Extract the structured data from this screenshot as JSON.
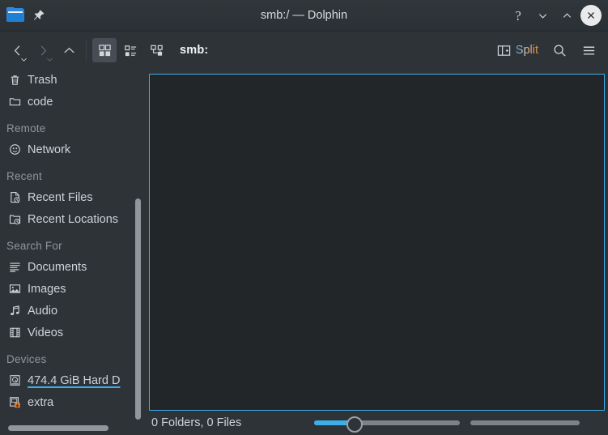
{
  "window": {
    "title": "smb:/ — Dolphin",
    "app_icon": "folder-icon",
    "pin_icon": "pin-icon",
    "controls": [
      {
        "name": "help-button",
        "icon": "question-mark-icon",
        "glyph": "?"
      },
      {
        "name": "minimize-button",
        "icon": "chevron-down-icon"
      },
      {
        "name": "maximize-button",
        "icon": "chevron-up-icon"
      },
      {
        "name": "close-button",
        "icon": "close-x-icon"
      }
    ]
  },
  "toolbar": {
    "back": {
      "label": "Back",
      "icon": "chevron-left-icon",
      "enabled": true
    },
    "forward": {
      "label": "Forward",
      "icon": "chevron-right-icon",
      "enabled": false
    },
    "up": {
      "label": "Up",
      "icon": "chevron-up-icon",
      "enabled": true
    },
    "view_modes": [
      {
        "name": "icons-view",
        "icon": "grid-icon",
        "active": true
      },
      {
        "name": "compact-view",
        "icon": "list-icon",
        "active": false
      },
      {
        "name": "details-view",
        "icon": "tree-icon",
        "active": false
      }
    ],
    "breadcrumb": "smb:",
    "split_label": "Split",
    "split_icon": "split-view-icon",
    "search_icon": "search-icon",
    "menu_icon": "hamburger-menu-icon"
  },
  "sidebar": {
    "groups": [
      {
        "heading": null,
        "items": [
          {
            "label": "Trash",
            "icon": "trash-icon",
            "hovered": false
          },
          {
            "label": "code",
            "icon": "folder-icon",
            "hovered": false
          }
        ]
      },
      {
        "heading": "Remote",
        "items": [
          {
            "label": "Network",
            "icon": "network-icon",
            "hovered": false
          }
        ]
      },
      {
        "heading": "Recent",
        "items": [
          {
            "label": "Recent Files",
            "icon": "recent-files-icon",
            "hovered": false
          },
          {
            "label": "Recent Locations",
            "icon": "recent-locations-icon",
            "hovered": false
          }
        ]
      },
      {
        "heading": "Search For",
        "items": [
          {
            "label": "Documents",
            "icon": "document-icon",
            "hovered": false
          },
          {
            "label": "Images",
            "icon": "image-icon",
            "hovered": false
          },
          {
            "label": "Audio",
            "icon": "audio-note-icon",
            "hovered": false
          },
          {
            "label": "Videos",
            "icon": "film-icon",
            "hovered": false
          }
        ]
      },
      {
        "heading": "Devices",
        "items": [
          {
            "label": "474.4 GiB Hard D",
            "icon": "hard-drive-icon",
            "hovered": true
          },
          {
            "label": "extra",
            "icon": "removable-device-icon",
            "hovered": false
          }
        ]
      }
    ]
  },
  "statusbar": {
    "text": "0 Folders, 0 Files",
    "zoom_value": 22,
    "zoom_min": 0,
    "zoom_max": 100
  },
  "colors": {
    "accent": "#3daee9",
    "window_bg": "#2e3338",
    "view_bg": "#232629",
    "text": "#cdd3d9",
    "heading_text": "#8e959c",
    "scrollbar": "#8f969c",
    "device_badge": "#e87d2c"
  }
}
